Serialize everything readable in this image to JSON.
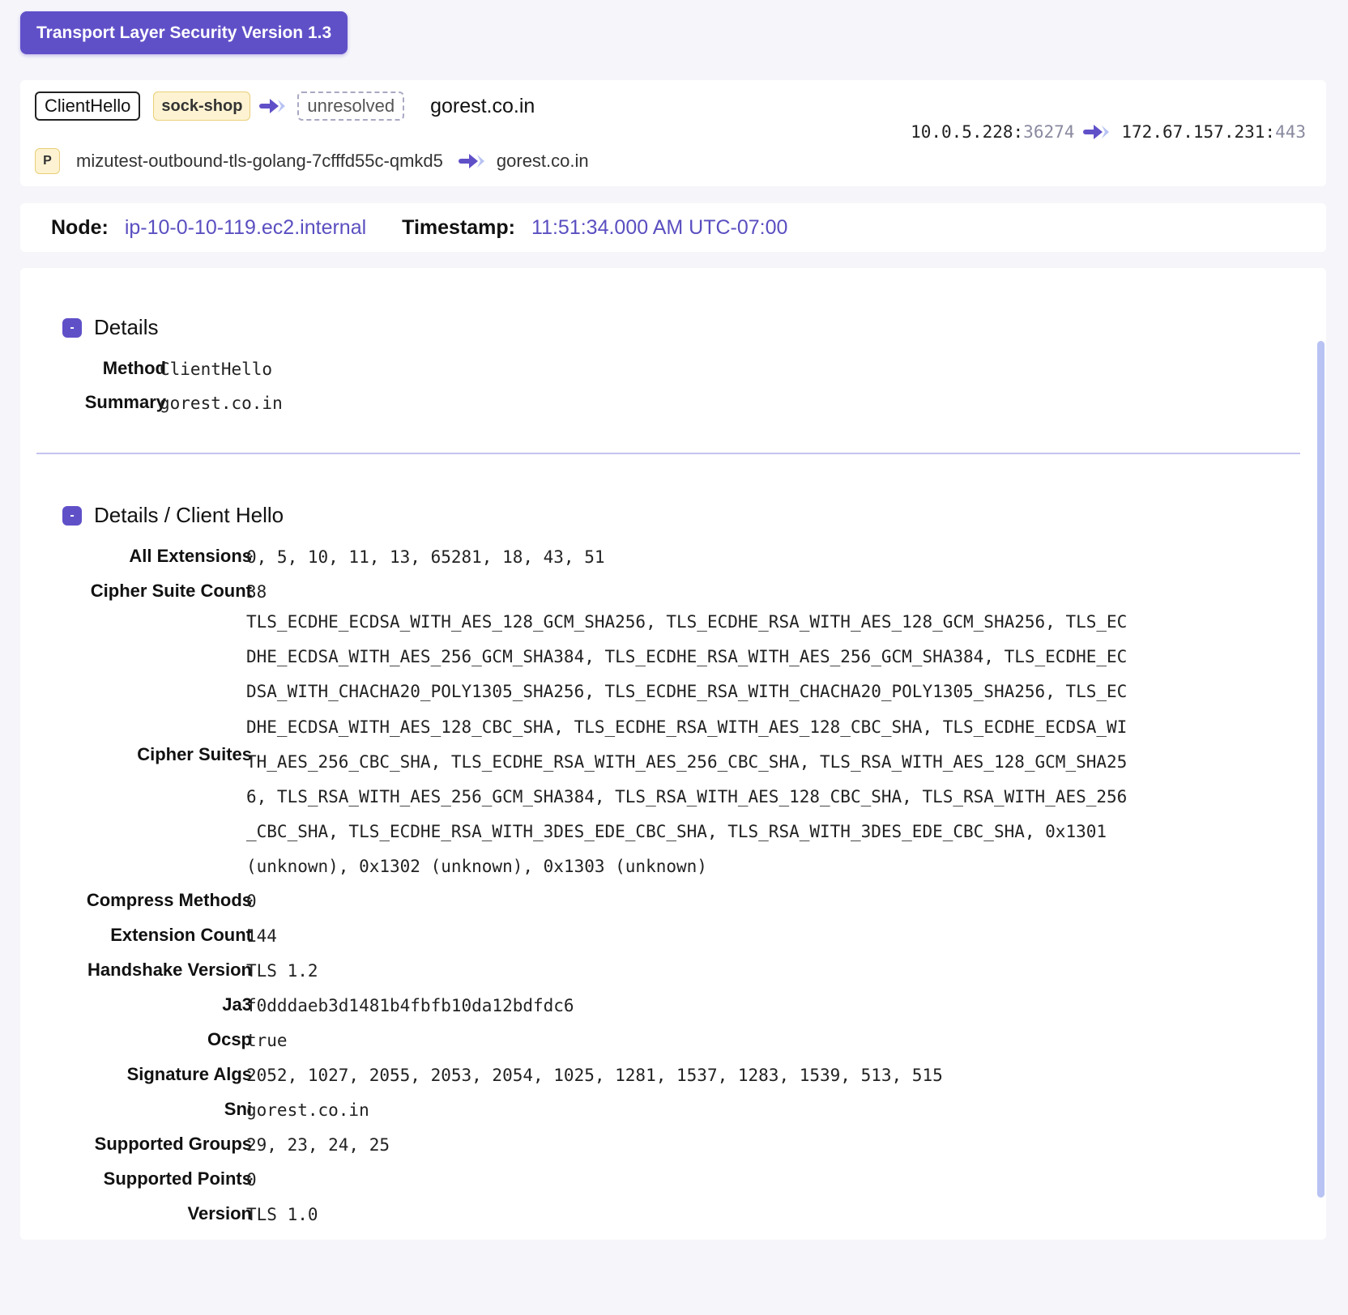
{
  "protocol": {
    "label": "Transport Layer Security Version 1.3"
  },
  "summary": {
    "method": "ClientHello",
    "namespace": "sock-shop",
    "unresolved": "unresolved",
    "destination": "gorest.co.in",
    "pod_tag": "P",
    "pod_name": "mizutest-outbound-tls-golang-7cfffd55c-qmkd5",
    "pod_destination": "gorest.co.in",
    "src_ip": "10.0.5.228",
    "src_port": "36274",
    "dst_ip": "172.67.157.231",
    "dst_port": "443",
    "colon": ":"
  },
  "meta": {
    "node_label": "Node:",
    "node_value": "ip-10-0-10-119.ec2.internal",
    "timestamp_label": "Timestamp:",
    "timestamp_value": "11:51:34.000 AM UTC-07:00"
  },
  "details": {
    "collapse_symbol": "-",
    "title": "Details",
    "method_label": "Method",
    "method_value": "ClientHello",
    "summary_label": "Summary",
    "summary_value": "gorest.co.in"
  },
  "client_hello": {
    "title": "Details / Client Hello",
    "fields": {
      "all_extensions": {
        "label": "All Extensions",
        "value": "0, 5, 10, 11, 13, 65281, 18, 43, 51"
      },
      "cipher_suite_count": {
        "label": "Cipher Suite Count",
        "value": "38"
      },
      "cipher_suites": {
        "label": "Cipher Suites",
        "value": "TLS_ECDHE_ECDSA_WITH_AES_128_GCM_SHA256, TLS_ECDHE_RSA_WITH_AES_128_GCM_SHA256, TLS_EC\nDHE_ECDSA_WITH_AES_256_GCM_SHA384, TLS_ECDHE_RSA_WITH_AES_256_GCM_SHA384, TLS_ECDHE_EC\nDSA_WITH_CHACHA20_POLY1305_SHA256, TLS_ECDHE_RSA_WITH_CHACHA20_POLY1305_SHA256, TLS_EC\nDHE_ECDSA_WITH_AES_128_CBC_SHA, TLS_ECDHE_RSA_WITH_AES_128_CBC_SHA, TLS_ECDHE_ECDSA_WI\nTH_AES_256_CBC_SHA, TLS_ECDHE_RSA_WITH_AES_256_CBC_SHA, TLS_RSA_WITH_AES_128_GCM_SHA25\n6, TLS_RSA_WITH_AES_256_GCM_SHA384, TLS_RSA_WITH_AES_128_CBC_SHA, TLS_RSA_WITH_AES_256\n_CBC_SHA, TLS_ECDHE_RSA_WITH_3DES_EDE_CBC_SHA, TLS_RSA_WITH_3DES_EDE_CBC_SHA, 0x1301\n(unknown), 0x1302 (unknown), 0x1303 (unknown)"
      },
      "compress_methods": {
        "label": "Compress Methods",
        "value": "0"
      },
      "extension_count": {
        "label": "Extension Count",
        "value": "144"
      },
      "handshake_version": {
        "label": "Handshake Version",
        "value": "TLS 1.2"
      },
      "ja3": {
        "label": "Ja3",
        "value": "f0dddaeb3d1481b4fbfb10da12bdfdc6"
      },
      "ocsp": {
        "label": "Ocsp",
        "value": "true"
      },
      "signature_algs": {
        "label": "Signature Algs",
        "value": "2052, 1027, 2055, 2053, 2054, 1025, 1281, 1537, 1283, 1539, 513, 515"
      },
      "sni": {
        "label": "Sni",
        "value": "gorest.co.in"
      },
      "supported_groups": {
        "label": "Supported Groups",
        "value": "29, 23, 24, 25"
      },
      "supported_points": {
        "label": "Supported Points",
        "value": "0"
      },
      "version": {
        "label": "Version",
        "value": "TLS 1.0"
      }
    }
  },
  "colors": {
    "accent": "#6050c8",
    "link": "#5a4fc0",
    "namespace_bg": "#fdf3d2",
    "divider": "#c5c3ee",
    "scrollbar": "#b8c3f3"
  },
  "icons": {
    "flow_arrow": "double-chevron-arrow-icon",
    "collapse": "collapse-minus-icon"
  }
}
